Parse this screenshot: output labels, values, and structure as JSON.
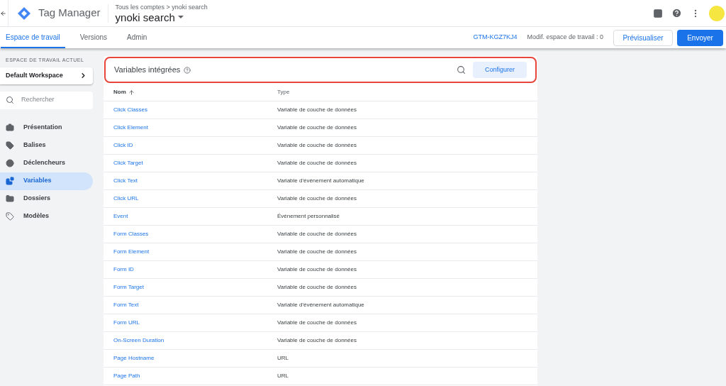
{
  "header": {
    "product": "Tag Manager",
    "breadcrumb": "Tous les comptes > ynoki search",
    "container": "ynoki search"
  },
  "tabs": [
    {
      "label": "Espace de travail",
      "selected": true
    },
    {
      "label": "Versions",
      "selected": false
    },
    {
      "label": "Admin",
      "selected": false
    }
  ],
  "toolbar": {
    "container_id": "GTM-KGZ7KJ4",
    "changes": "Modif. espace de travail : 0",
    "preview": "Prévisualiser",
    "submit": "Envoyer"
  },
  "sidebar": {
    "section_label": "ESPACE DE TRAVAIL ACTUEL",
    "workspace": "Default Workspace",
    "search_placeholder": "Rechercher",
    "items": [
      {
        "label": "Présentation",
        "selected": false
      },
      {
        "label": "Balises",
        "selected": false
      },
      {
        "label": "Déclencheurs",
        "selected": false
      },
      {
        "label": "Variables",
        "selected": true
      },
      {
        "label": "Dossiers",
        "selected": false
      },
      {
        "label": "Modèles",
        "selected": false
      }
    ]
  },
  "panel": {
    "title": "Variables intégrées",
    "configure": "Configurer",
    "columns": [
      "Nom",
      "Type"
    ],
    "rows": [
      {
        "name": "Click Classes",
        "type": "Variable de couche de données"
      },
      {
        "name": "Click Element",
        "type": "Variable de couche de données"
      },
      {
        "name": "Click ID",
        "type": "Variable de couche de données"
      },
      {
        "name": "Click Target",
        "type": "Variable de couche de données"
      },
      {
        "name": "Click Text",
        "type": "Variable d'événement automatique"
      },
      {
        "name": "Click URL",
        "type": "Variable de couche de données"
      },
      {
        "name": "Event",
        "type": "Événement personnalisé"
      },
      {
        "name": "Form Classes",
        "type": "Variable de couche de données"
      },
      {
        "name": "Form Element",
        "type": "Variable de couche de données"
      },
      {
        "name": "Form ID",
        "type": "Variable de couche de données"
      },
      {
        "name": "Form Target",
        "type": "Variable de couche de données"
      },
      {
        "name": "Form Text",
        "type": "Variable d'événement automatique"
      },
      {
        "name": "Form URL",
        "type": "Variable de couche de données"
      },
      {
        "name": "On-Screen Duration",
        "type": "Variable de couche de données"
      },
      {
        "name": "Page Hostname",
        "type": "URL"
      },
      {
        "name": "Page Path",
        "type": "URL"
      }
    ]
  }
}
